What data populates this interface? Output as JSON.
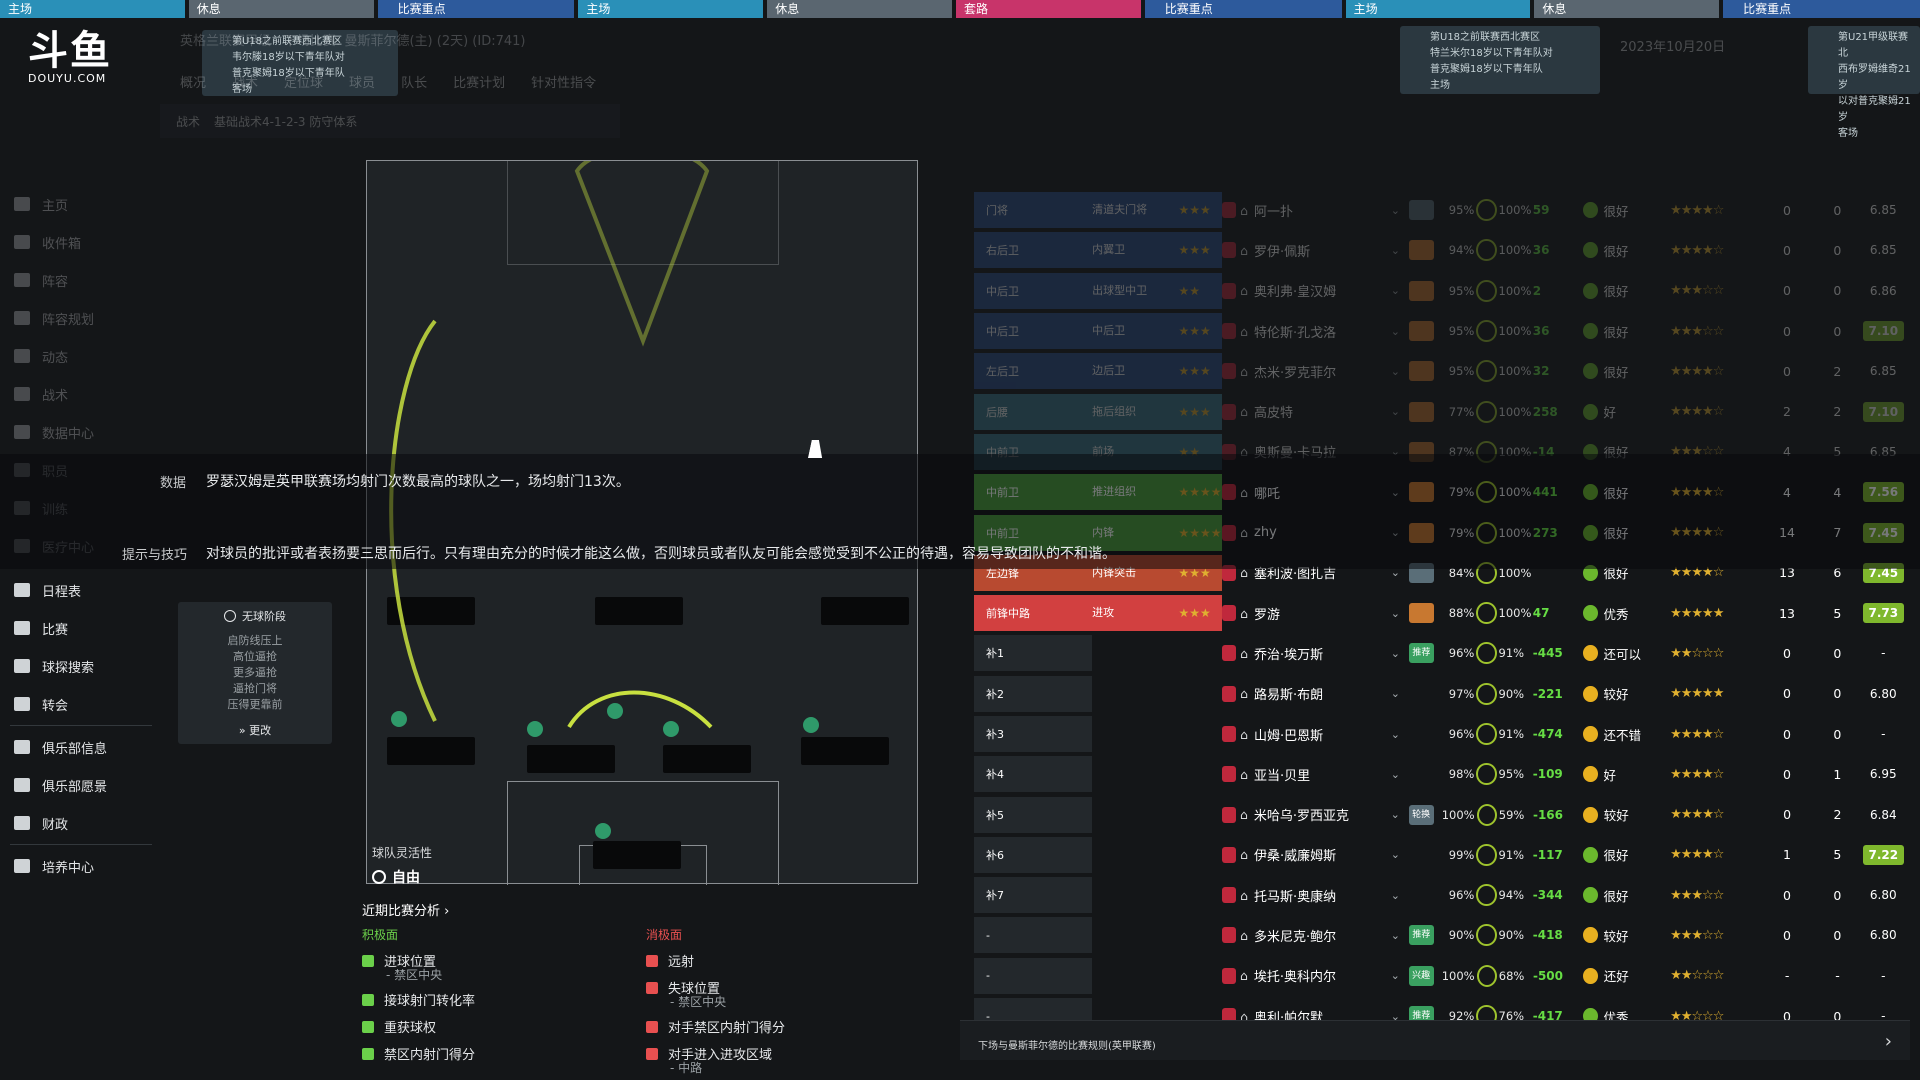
{
  "topbar": {
    "chips": [
      {
        "label": "主场",
        "color": "#2a90b8"
      },
      {
        "label": "休息",
        "color": "#5a6670"
      },
      {
        "label": "比赛重点",
        "color": "#2d5a9c"
      },
      {
        "label": "主场",
        "color": "#2a90b8"
      },
      {
        "label": "休息",
        "color": "#5a6670"
      },
      {
        "label": "套路",
        "color": "#c8346a"
      },
      {
        "label": "比赛重点",
        "color": "#2d5a9c"
      },
      {
        "label": "主场",
        "color": "#2a90b8"
      },
      {
        "label": "休息",
        "color": "#5a6670"
      },
      {
        "label": "比赛重点",
        "color": "#2d5a9c"
      }
    ]
  },
  "logo": {
    "mark": "斗鱼",
    "sub": "DOUYU.COM"
  },
  "notifications": [
    {
      "lines": [
        "第U18之前联赛西北赛区",
        "韦尔滕18岁以下青年队对",
        "普克聚姆18岁以下青年队",
        "客场"
      ]
    },
    {
      "lines": [
        "第U18之前联赛西北赛区",
        "特兰米尔18岁以下青年队对",
        "普克聚姆18岁以下青年队",
        "主场"
      ]
    },
    {
      "lines": [
        "第U21甲级联赛北",
        "西布罗姆维奇21岁",
        "以对普克聚姆21岁",
        "客场"
      ]
    }
  ],
  "breadcrumb": "英格兰联赛甲级 - 下场比赛: 曼斯菲尔德(主) (2天) (ID:741)",
  "date_text": "2023年10月20日",
  "subtabs": [
    "概况",
    "战术",
    "定位球",
    "球员",
    "队长",
    "比赛计划",
    "针对性指令"
  ],
  "tactics_bar": {
    "label": "战术",
    "formation": "基础战术4-1-2-3 防守体系",
    "analysis": "分析"
  },
  "sidebar": {
    "items": [
      {
        "label": "主页",
        "icon": "home-icon",
        "bright": false
      },
      {
        "label": "收件箱",
        "icon": "inbox-icon",
        "bright": false
      },
      {
        "label": "阵容",
        "icon": "squad-icon",
        "bright": false
      },
      {
        "label": "阵容规划",
        "icon": "planner-icon",
        "bright": false
      },
      {
        "label": "动态",
        "icon": "dynamics-icon",
        "bright": false
      },
      {
        "label": "战术",
        "icon": "tactics-icon",
        "bright": false
      },
      {
        "label": "数据中心",
        "icon": "data-icon",
        "bright": false
      },
      {
        "label": "职员",
        "icon": "staff-icon",
        "bright": false
      },
      {
        "label": "训练",
        "icon": "training-icon",
        "bright": false
      },
      {
        "label": "医疗中心",
        "icon": "medical-icon",
        "bright": false
      },
      {
        "label": "日程表",
        "icon": "calendar-icon",
        "bright": true
      },
      {
        "label": "比赛",
        "icon": "trophy-icon",
        "bright": true
      },
      {
        "label": "球探搜索",
        "icon": "search-icon",
        "bright": true
      },
      {
        "label": "转会",
        "icon": "transfer-icon",
        "bright": true
      },
      {
        "label": "俱乐部信息",
        "icon": "shield-icon",
        "bright": true
      },
      {
        "label": "俱乐部愿景",
        "icon": "vision-icon",
        "bright": true
      },
      {
        "label": "财政",
        "icon": "finance-icon",
        "bright": true
      },
      {
        "label": "培养中心",
        "icon": "development-icon",
        "bright": true
      }
    ]
  },
  "overlay": {
    "data_label": "数据",
    "data_text": "罗瑟汉姆是英甲联赛场均射门次数最高的球队之一，场均射门13次。",
    "tips_label": "提示与技巧",
    "tips_text": "对球员的批评或者表扬要三思而后行。只有理由充分的时候才能这么做，否则球员或者队友可能会感觉受到不公正的待遇，容易导致团队的不和谐。"
  },
  "instructions_panel": {
    "header": "无球阶段",
    "lines": [
      "启防线压上",
      "高位逼抢",
      "更多逼抢",
      "逼抢门将",
      "压得更靠前"
    ],
    "more": "更改"
  },
  "pitch": {
    "flex_label": "球队灵活性",
    "flex_value": "自由"
  },
  "analysis": {
    "title": "近期比赛分析 ›",
    "positive_title": "积极面",
    "negative_title": "消极面",
    "positive": [
      {
        "text": "进球位置",
        "sub": "- 禁区中央"
      },
      {
        "text": "接球射门转化率",
        "sub": ""
      },
      {
        "text": "重获球权",
        "sub": ""
      },
      {
        "text": "禁区内射门得分",
        "sub": ""
      }
    ],
    "negative": [
      {
        "text": "远射",
        "sub": ""
      },
      {
        "text": "失球位置",
        "sub": "- 禁区中央"
      },
      {
        "text": "对手禁区内射门得分",
        "sub": ""
      },
      {
        "text": "对手进入进攻区域",
        "sub": "- 中路"
      }
    ]
  },
  "squad": {
    "rows": [
      {
        "pos": "门将",
        "role": "清道夫门将",
        "pstars": 3,
        "name": "阿一扑",
        "badge": "",
        "badge_color": "#5a6e78",
        "cond": "95%",
        "sharp": "100%",
        "tval": "59",
        "form": "很好",
        "fcolor": "#6bb82d",
        "rstars": 3.5,
        "n1": "0",
        "n2": "0",
        "rating": "6.85",
        "hi": false,
        "dim": true,
        "bg": "#2b4e8c"
      },
      {
        "pos": "右后卫",
        "role": "内翼卫",
        "pstars": 3,
        "name": "罗伊·佩斯",
        "badge": "",
        "badge_color": "#c87830",
        "cond": "94%",
        "sharp": "100%",
        "tval": "36",
        "form": "很好",
        "fcolor": "#6bb82d",
        "rstars": 4,
        "n1": "0",
        "n2": "0",
        "rating": "6.85",
        "hi": false,
        "dim": true,
        "bg": "#2b4e8c"
      },
      {
        "pos": "中后卫",
        "role": "出球型中卫",
        "pstars": 2,
        "name": "奥利弗·皇汉姆",
        "badge": "",
        "badge_color": "#c87830",
        "cond": "95%",
        "sharp": "100%",
        "tval": "2",
        "form": "很好",
        "fcolor": "#6bb82d",
        "rstars": 3,
        "n1": "0",
        "n2": "0",
        "rating": "6.86",
        "hi": false,
        "dim": true,
        "bg": "#2b4e8c"
      },
      {
        "pos": "中后卫",
        "role": "中后卫",
        "pstars": 3,
        "name": "特伦斯·孔戈洛",
        "badge": "",
        "badge_color": "#c87830",
        "cond": "95%",
        "sharp": "100%",
        "tval": "36",
        "form": "很好",
        "fcolor": "#6bb82d",
        "rstars": 2.5,
        "n1": "0",
        "n2": "0",
        "rating": "7.10",
        "hi": true,
        "dim": true,
        "bg": "#2b4e8c"
      },
      {
        "pos": "左后卫",
        "role": "边后卫",
        "pstars": 3,
        "name": "杰米·罗克菲尔",
        "badge": "",
        "badge_color": "#c87830",
        "cond": "95%",
        "sharp": "100%",
        "tval": "32",
        "form": "很好",
        "fcolor": "#6bb82d",
        "rstars": 4,
        "n1": "0",
        "n2": "2",
        "rating": "6.85",
        "hi": false,
        "dim": true,
        "bg": "#2b4e8c"
      },
      {
        "pos": "后腰",
        "role": "拖后组织",
        "pstars": 3,
        "name": "高皮特",
        "badge": "",
        "badge_color": "#c87830",
        "cond": "77%",
        "sharp": "100%",
        "tval": "258",
        "form": "好",
        "fcolor": "#6bb82d",
        "rstars": 4,
        "n1": "2",
        "n2": "2",
        "rating": "7.10",
        "hi": true,
        "dim": true,
        "bg": "#3a7a8e"
      },
      {
        "pos": "中前卫",
        "role": "前场",
        "pstars": 2,
        "name": "奥斯曼·卡马拉",
        "badge": "",
        "badge_color": "#c87830",
        "cond": "87%",
        "sharp": "100%",
        "tval": "-14",
        "form": "很好",
        "fcolor": "#6bb82d",
        "rstars": 3,
        "n1": "4",
        "n2": "5",
        "rating": "6.85",
        "hi": false,
        "dim": true,
        "bg": "#3a7a8e"
      },
      {
        "pos": "中前卫",
        "role": "推进组织",
        "pstars": 4,
        "name": "哪吒",
        "badge": "",
        "badge_color": "#c87830",
        "cond": "79%",
        "sharp": "100%",
        "tval": "441",
        "form": "很好",
        "fcolor": "#6bb82d",
        "rstars": 4,
        "n1": "4",
        "n2": "4",
        "rating": "7.56",
        "hi": true,
        "dim": false,
        "bg": "#4d9e3c"
      },
      {
        "pos": "中前卫",
        "role": "内锋",
        "pstars": 4,
        "name": "zhy",
        "badge": "",
        "badge_color": "#c87830",
        "cond": "79%",
        "sharp": "100%",
        "tval": "273",
        "form": "很好",
        "fcolor": "#6bb82d",
        "rstars": 4,
        "n1": "14",
        "n2": "7",
        "rating": "7.45",
        "hi": true,
        "dim": false,
        "bg": "#4d9e3c"
      },
      {
        "pos": "左边锋",
        "role": "内锋突击",
        "pstars": 3,
        "name": "塞利波·图扎吉",
        "badge": "",
        "badge_color": "#5a6e78",
        "cond": "84%",
        "sharp": "100%",
        "tval": "",
        "form": "很好",
        "fcolor": "#6bb82d",
        "rstars": 4,
        "n1": "13",
        "n2": "6",
        "rating": "7.45",
        "hi": true,
        "dim": false,
        "bg": "#b84a30"
      },
      {
        "pos": "前锋中路",
        "role": "进攻",
        "pstars": 3,
        "name": "罗游",
        "badge": "",
        "badge_color": "#c87830",
        "cond": "88%",
        "sharp": "100%",
        "tval": "47",
        "form": "优秀",
        "fcolor": "#6bb82d",
        "rstars": 5,
        "n1": "13",
        "n2": "5",
        "rating": "7.73",
        "hi": true,
        "dim": false,
        "bg": "#d24040"
      }
    ],
    "subs": [
      {
        "pos": "补1",
        "name": "乔治·埃万斯",
        "badge": "推荐",
        "badge_color": "#3aa060",
        "cond": "96%",
        "sharp": "91%",
        "tval": "-445",
        "form": "还可以",
        "fcolor": "#e8b020",
        "rstars": 2,
        "n1": "0",
        "n2": "0",
        "rating": "-",
        "hi": false
      },
      {
        "pos": "补2",
        "name": "路易斯·布朗",
        "badge": "",
        "badge_color": "",
        "cond": "97%",
        "sharp": "90%",
        "tval": "-221",
        "form": "较好",
        "fcolor": "#e8b020",
        "rstars": 4.5,
        "n1": "0",
        "n2": "0",
        "rating": "6.80",
        "hi": false
      },
      {
        "pos": "补3",
        "name": "山姆·巴恩斯",
        "badge": "",
        "badge_color": "",
        "cond": "96%",
        "sharp": "91%",
        "tval": "-474",
        "form": "还不错",
        "fcolor": "#e8b020",
        "rstars": 3.5,
        "n1": "0",
        "n2": "0",
        "rating": "-",
        "hi": false
      },
      {
        "pos": "补4",
        "name": "亚当·贝里",
        "badge": "",
        "badge_color": "",
        "cond": "98%",
        "sharp": "95%",
        "tval": "-109",
        "form": "好",
        "fcolor": "#e8b020",
        "rstars": 3.5,
        "n1": "0",
        "n2": "1",
        "rating": "6.95",
        "hi": false
      },
      {
        "pos": "补5",
        "name": "米哈乌·罗西亚克",
        "badge": "轮换",
        "badge_color": "#5a6e78",
        "cond": "100%",
        "sharp": "59%",
        "tval": "-166",
        "form": "较好",
        "fcolor": "#e8b020",
        "rstars": 4,
        "n1": "0",
        "n2": "2",
        "rating": "6.84",
        "hi": false
      },
      {
        "pos": "补6",
        "name": "伊桑·威廉姆斯",
        "badge": "",
        "badge_color": "",
        "cond": "99%",
        "sharp": "91%",
        "tval": "-117",
        "form": "很好",
        "fcolor": "#6bb82d",
        "rstars": 3.5,
        "n1": "1",
        "n2": "5",
        "rating": "7.22",
        "hi": true
      },
      {
        "pos": "补7",
        "name": "托马斯·奥康纳",
        "badge": "",
        "badge_color": "",
        "cond": "96%",
        "sharp": "94%",
        "tval": "-344",
        "form": "很好",
        "fcolor": "#6bb82d",
        "rstars": 2.5,
        "n1": "0",
        "n2": "0",
        "rating": "6.80",
        "hi": false
      },
      {
        "pos": "-",
        "name": "多米尼克·鲍尔",
        "badge": "推荐",
        "badge_color": "#3aa060",
        "cond": "90%",
        "sharp": "90%",
        "tval": "-418",
        "form": "较好",
        "fcolor": "#e8b020",
        "rstars": 2.5,
        "n1": "0",
        "n2": "0",
        "rating": "6.80",
        "hi": false
      },
      {
        "pos": "-",
        "name": "埃托·奥科内尔",
        "badge": "兴趣",
        "badge_color": "#3aa060",
        "cond": "100%",
        "sharp": "68%",
        "tval": "-500",
        "form": "还好",
        "fcolor": "#e8b020",
        "rstars": 2,
        "n1": "-",
        "n2": "-",
        "rating": "-",
        "hi": false
      },
      {
        "pos": "-",
        "name": "奥利·帕尔默",
        "badge": "推荐",
        "badge_color": "#3aa060",
        "cond": "92%",
        "sharp": "76%",
        "tval": "-417",
        "form": "优秀",
        "fcolor": "#6bb82d",
        "rstars": 2,
        "n1": "0",
        "n2": "0",
        "rating": "-",
        "hi": false
      }
    ]
  },
  "bottombar": {
    "text": "下场与曼斯菲尔德的比赛规则(英甲联赛)",
    "arrow": "›"
  }
}
